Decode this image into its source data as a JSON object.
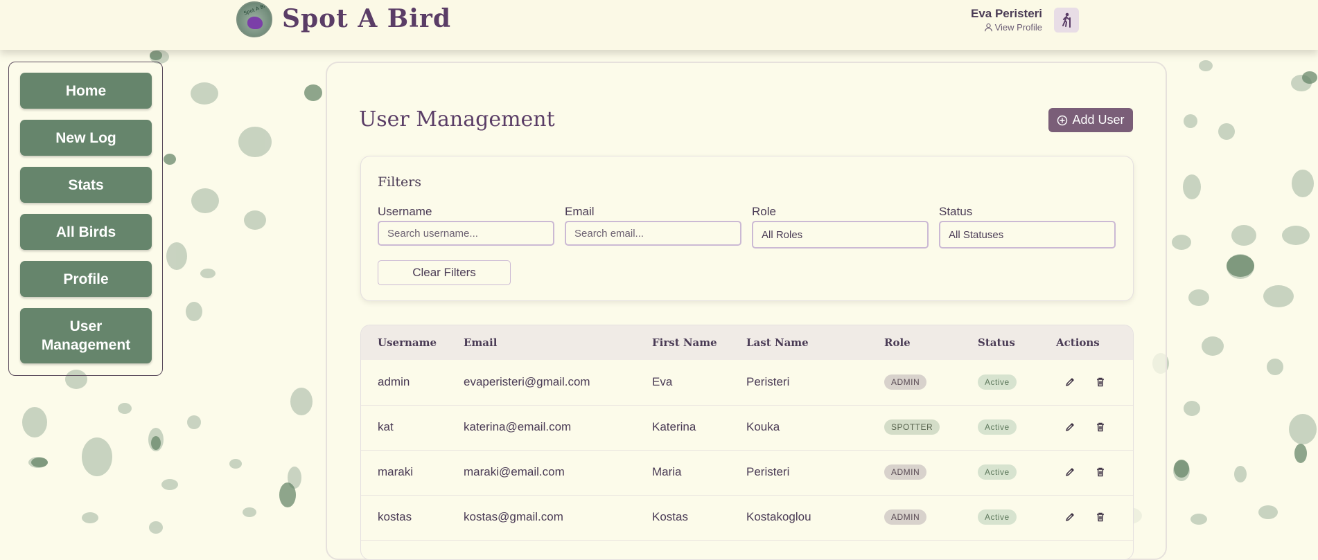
{
  "header": {
    "app_title": "Spot A Bird",
    "logo_text": "Spot A Bird",
    "user_name": "Eva Peristeri",
    "view_profile": "View Profile"
  },
  "sidebar": {
    "items": [
      {
        "label": "Home"
      },
      {
        "label": "New Log"
      },
      {
        "label": "Stats"
      },
      {
        "label": "All Birds"
      },
      {
        "label": "Profile"
      },
      {
        "label": "User Management"
      }
    ]
  },
  "main": {
    "title": "User Management",
    "add_user_label": "Add User",
    "filters": {
      "title": "Filters",
      "username_label": "Username",
      "username_placeholder": "Search username...",
      "email_label": "Email",
      "email_placeholder": "Search email...",
      "role_label": "Role",
      "role_value": "All Roles",
      "status_label": "Status",
      "status_value": "All Statuses",
      "clear_label": "Clear Filters"
    },
    "table": {
      "headers": [
        "Username",
        "Email",
        "First Name",
        "Last Name",
        "Role",
        "Status",
        "Actions"
      ],
      "rows": [
        {
          "username": "admin",
          "email": "evaperisteri@gmail.com",
          "first": "Eva",
          "last": "Peristeri",
          "role": "ADMIN",
          "status": "Active"
        },
        {
          "username": "kat",
          "email": "katerina@email.com",
          "first": "Katerina",
          "last": "Kouka",
          "role": "SPOTTER",
          "status": "Active"
        },
        {
          "username": "maraki",
          "email": "maraki@email.com",
          "first": "Maria",
          "last": "Peristeri",
          "role": "ADMIN",
          "status": "Active"
        },
        {
          "username": "kostas",
          "email": "kostas@gmail.com",
          "first": "Kostas",
          "last": "Kostakoglou",
          "role": "ADMIN",
          "status": "Active"
        }
      ]
    }
  },
  "colors": {
    "background": "#fcfbea",
    "nav_green": "#66856c",
    "accent_purple": "#7a5e78",
    "title_purple": "#5a3d66"
  }
}
